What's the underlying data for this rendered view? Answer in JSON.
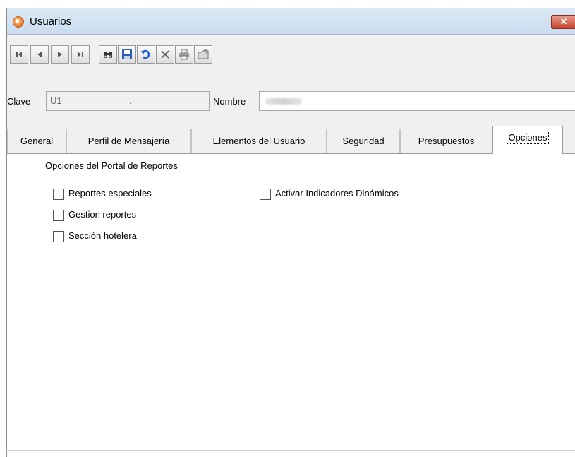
{
  "window": {
    "title": "Usuarios",
    "close_label": "✕"
  },
  "toolbar": {
    "buttons": [
      "first-icon",
      "previous-icon",
      "next-icon",
      "last-icon",
      "binoculars-icon",
      "save-icon",
      "undo-icon",
      "delete-icon",
      "print-icon",
      "export-icon"
    ]
  },
  "form": {
    "clave_label": "Clave",
    "clave_value": "U1",
    "clave_dot": ".",
    "nombre_label": "Nombre",
    "nombre_value": ""
  },
  "tabs": [
    "General",
    "Perfil de Mensajería",
    "Elementos del Usuario",
    "Seguridad",
    "Presupuestos",
    "Opciones"
  ],
  "active_tab": "Opciones",
  "options": {
    "group_title": "Opciones del Portal de Reportes",
    "items": [
      "Reportes especiales",
      "Gestion reportes",
      "Sección hotelera",
      "Activar Indicadores Dinámicos"
    ],
    "checked": [
      false,
      false,
      false,
      false
    ]
  }
}
